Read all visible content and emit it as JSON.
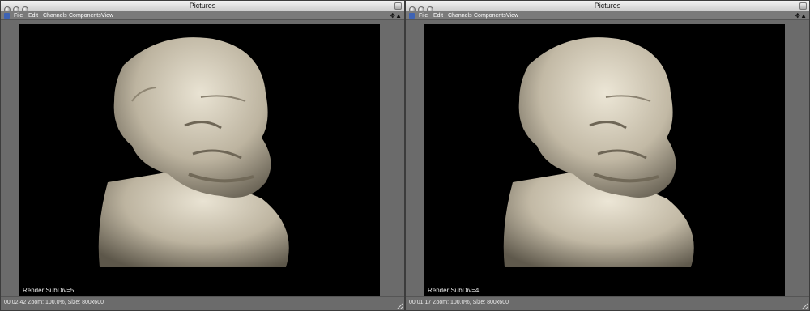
{
  "windows": [
    {
      "title": "Pictures",
      "menu": [
        "File",
        "Edit",
        "Channels",
        "Components",
        "View"
      ],
      "render_label": "Render SubDiv=5",
      "status": {
        "time": "00:02:42",
        "info": "Zoom: 100.0%, Size: 800x600"
      }
    },
    {
      "title": "Pictures",
      "menu": [
        "File",
        "Edit",
        "Channels",
        "Components",
        "View"
      ],
      "render_label": "Render SubDiv=4",
      "status": {
        "time": "00:01:17",
        "info": "Zoom: 100.0%, Size: 800x600"
      }
    }
  ],
  "icons": {
    "window_controls": [
      "close-icon",
      "minimize-icon",
      "zoom-icon"
    ],
    "app": "app-icon",
    "tools": [
      "move-icon",
      "triangle-icon"
    ],
    "corner": "window-collapse-icon"
  },
  "colors": {
    "render_background": "#000000",
    "sculpt": "#c9c1ad",
    "window_chrome": "#6b6b6b"
  }
}
